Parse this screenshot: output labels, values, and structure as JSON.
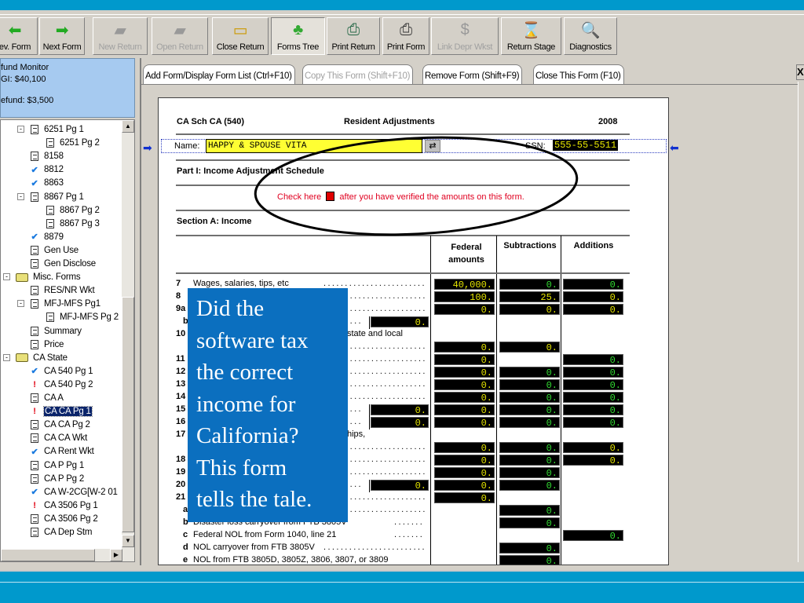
{
  "toolbar": [
    {
      "label": "ev. Form",
      "icon": "back-arrow-icon",
      "state": "normal"
    },
    {
      "label": "Next Form",
      "icon": "forward-arrow-icon",
      "state": "normal"
    },
    {
      "label": "New Return",
      "icon": "new-return-icon",
      "state": "disabled"
    },
    {
      "label": "Open Return",
      "icon": "open-return-icon",
      "state": "disabled"
    },
    {
      "label": "Close Return",
      "icon": "folder-icon",
      "state": "normal"
    },
    {
      "label": "Forms Tree",
      "icon": "tree-icon",
      "state": "pressed"
    },
    {
      "label": "Print Return",
      "icon": "printer-green-icon",
      "state": "normal"
    },
    {
      "label": "Print Form",
      "icon": "printer-icon",
      "state": "normal"
    },
    {
      "label": "Link Depr Wkst",
      "icon": "dollar-link-icon",
      "state": "disabled"
    },
    {
      "label": "Return Stage",
      "icon": "hourglass-icon",
      "state": "normal"
    },
    {
      "label": "Diagnostics",
      "icon": "magnifier-icon",
      "state": "normal"
    }
  ],
  "monitor": {
    "title": "fund Monitor",
    "agi": "GI: $40,100",
    "refund": "efund: $3,500"
  },
  "tree": [
    {
      "label": "6251 Pg 1",
      "icon": "doc",
      "level": 2,
      "exp": "-"
    },
    {
      "label": "6251 Pg 2",
      "icon": "doc",
      "level": 3
    },
    {
      "label": "8158",
      "icon": "doc",
      "level": 2
    },
    {
      "label": "8812",
      "icon": "check",
      "level": 2
    },
    {
      "label": "8863",
      "icon": "check",
      "level": 2
    },
    {
      "label": "8867 Pg 1",
      "icon": "doc",
      "level": 2,
      "exp": "-"
    },
    {
      "label": "8867 Pg 2",
      "icon": "doc",
      "level": 3
    },
    {
      "label": "8867 Pg 3",
      "icon": "doc",
      "level": 3
    },
    {
      "label": "8879",
      "icon": "check",
      "level": 2
    },
    {
      "label": "Gen Use",
      "icon": "doc",
      "level": 2
    },
    {
      "label": "Gen Disclose",
      "icon": "doc",
      "level": 2
    },
    {
      "label": "Misc. Forms",
      "icon": "folder",
      "level": 1,
      "exp": "-"
    },
    {
      "label": "RES/NR Wkt",
      "icon": "doc",
      "level": 2
    },
    {
      "label": "MFJ-MFS Pg1",
      "icon": "doc",
      "level": 2,
      "exp": "-"
    },
    {
      "label": "MFJ-MFS Pg 2",
      "icon": "doc",
      "level": 3
    },
    {
      "label": "Summary",
      "icon": "doc",
      "level": 2
    },
    {
      "label": "Price",
      "icon": "doc",
      "level": 2
    },
    {
      "label": "CA State",
      "icon": "folder",
      "level": 1,
      "exp": "-"
    },
    {
      "label": "CA 540 Pg 1",
      "icon": "check",
      "level": 2
    },
    {
      "label": "CA 540 Pg 2",
      "icon": "alert",
      "level": 2
    },
    {
      "label": "CA A",
      "icon": "doc",
      "level": 2
    },
    {
      "label": "CA CA Pg 1",
      "icon": "alert",
      "level": 2,
      "selected": true
    },
    {
      "label": "CA CA Pg 2",
      "icon": "doc",
      "level": 2
    },
    {
      "label": "CA CA Wkt",
      "icon": "doc",
      "level": 2
    },
    {
      "label": "CA Rent Wkt",
      "icon": "check",
      "level": 2
    },
    {
      "label": "CA P Pg 1",
      "icon": "doc",
      "level": 2
    },
    {
      "label": "CA P Pg 2",
      "icon": "doc",
      "level": 2
    },
    {
      "label": "CA W-2CG[W-2 01",
      "icon": "check",
      "level": 2
    },
    {
      "label": "CA 3506 Pg 1",
      "icon": "alert",
      "level": 2
    },
    {
      "label": "CA 3506 Pg 2",
      "icon": "doc",
      "level": 2
    },
    {
      "label": "CA Dep Stm",
      "icon": "doc",
      "level": 2
    }
  ],
  "tabs": [
    {
      "label": "Add Form/Display Form List (Ctrl+F10)",
      "enabled": true
    },
    {
      "label": "Copy This Form (Shift+F10)",
      "enabled": false
    },
    {
      "label": "Remove Form (Shift+F9)",
      "enabled": true
    },
    {
      "label": "Close This Form (F10)",
      "enabled": true
    }
  ],
  "close_label": "X",
  "form": {
    "form_id": "CA Sch CA (540)",
    "title": "Resident Adjustments",
    "year": "2008",
    "name_label": "Name:",
    "name_value": "HAPPY & SPOUSE VITA",
    "ssn_label": "SSN:",
    "ssn_value": "555-55-5511",
    "part": "Part I:  Income Adjustment Schedule",
    "check_pre": "Check here",
    "check_post": "after you have verified the amounts on this form.",
    "section": "Section A:  Income",
    "col_federal": "Federal amounts",
    "col_sub": "Subtractions",
    "col_add": "Additions",
    "colors": {
      "yellow": "#e6e600",
      "green": "#33dd33",
      "check_box": "#e00000",
      "name_field": "#ffff33"
    },
    "rows": [
      {
        "num": "7",
        "label": "Wages, salaries, tips, etc",
        "dots": true,
        "fed": "40,000.",
        "sub": [
          "0.",
          "g"
        ],
        "add": [
          "0.",
          "g"
        ]
      },
      {
        "num": "8",
        "dots": true,
        "fed": "100.",
        "sub": [
          "25.",
          "y"
        ],
        "add": [
          "0.",
          "y"
        ]
      },
      {
        "num": "9a",
        "dots": true,
        "fed": "0.",
        "sub": [
          "0.",
          "y"
        ],
        "add": [
          "0.",
          "y"
        ]
      },
      {
        "num": "b",
        "sub_indent": true,
        "dots": true,
        "inner": "0."
      },
      {
        "num": "10",
        "label_tail": "state and local"
      },
      {
        "num": "",
        "dots": true,
        "fed": "0.",
        "sub": [
          "0.",
          "y"
        ]
      },
      {
        "num": "11",
        "dots": true,
        "fed": "0.",
        "add": [
          "0.",
          "g"
        ]
      },
      {
        "num": "12",
        "dots": true,
        "fed": "0.",
        "sub": [
          "0.",
          "g"
        ],
        "add": [
          "0.",
          "g"
        ]
      },
      {
        "num": "13",
        "dots": true,
        "fed": "0.",
        "sub": [
          "0.",
          "g"
        ],
        "add": [
          "0.",
          "g"
        ]
      },
      {
        "num": "14",
        "dots": true,
        "fed": "0.",
        "sub": [
          "0.",
          "g"
        ],
        "add": [
          "0.",
          "g"
        ]
      },
      {
        "num": "15",
        "dots": true,
        "inner": "0.",
        "fed": "0.",
        "sub": [
          "0.",
          "g"
        ],
        "add": [
          "0.",
          "g"
        ]
      },
      {
        "num": "16",
        "dots": true,
        "inner": "0.",
        "fed": "0.",
        "sub": [
          "0.",
          "g"
        ],
        "add": [
          "0.",
          "g"
        ]
      },
      {
        "num": "17",
        "label_tail": "hips,"
      },
      {
        "num": "",
        "dots": true,
        "fed": "0.",
        "sub": [
          "0.",
          "g"
        ],
        "add": [
          "0.",
          "y"
        ]
      },
      {
        "num": "18",
        "dots": true,
        "fed": "0.",
        "sub": [
          "0.",
          "g"
        ],
        "add": [
          "0.",
          "y"
        ]
      },
      {
        "num": "19",
        "dots": true,
        "fed": "0.",
        "sub": [
          "0.",
          "g"
        ]
      },
      {
        "num": "20",
        "dots": true,
        "inner": "0.",
        "fed": "0.",
        "sub": [
          "0.",
          "g"
        ]
      },
      {
        "num": "21",
        "dots": true,
        "fed": "0."
      },
      {
        "num": "a",
        "sub_indent": true,
        "dots": true,
        "sub": [
          "0.",
          "g"
        ]
      },
      {
        "num": "b",
        "sub_indent": true,
        "label": "Disaster loss carryover from FTB 3805V",
        "dots": true,
        "sub": [
          "0.",
          "g"
        ]
      },
      {
        "num": "c",
        "sub_indent": true,
        "label": "Federal NOL from Form 1040, line 21",
        "dots": true,
        "add": [
          "0.",
          "g"
        ]
      },
      {
        "num": "d",
        "sub_indent": true,
        "label": "NOL carryover from FTB 3805V",
        "dots": true,
        "sub": [
          "0.",
          "g"
        ]
      },
      {
        "num": "e",
        "sub_indent": true,
        "label": "NOL from FTB 3805D, 3805Z, 3806, 3807, or 3809",
        "sub": [
          "0.",
          "g"
        ]
      }
    ]
  },
  "overlay": {
    "lines": [
      "Did the",
      "software tax",
      "the correct",
      "income for",
      "California?",
      "This form",
      "tells the tale."
    ]
  }
}
